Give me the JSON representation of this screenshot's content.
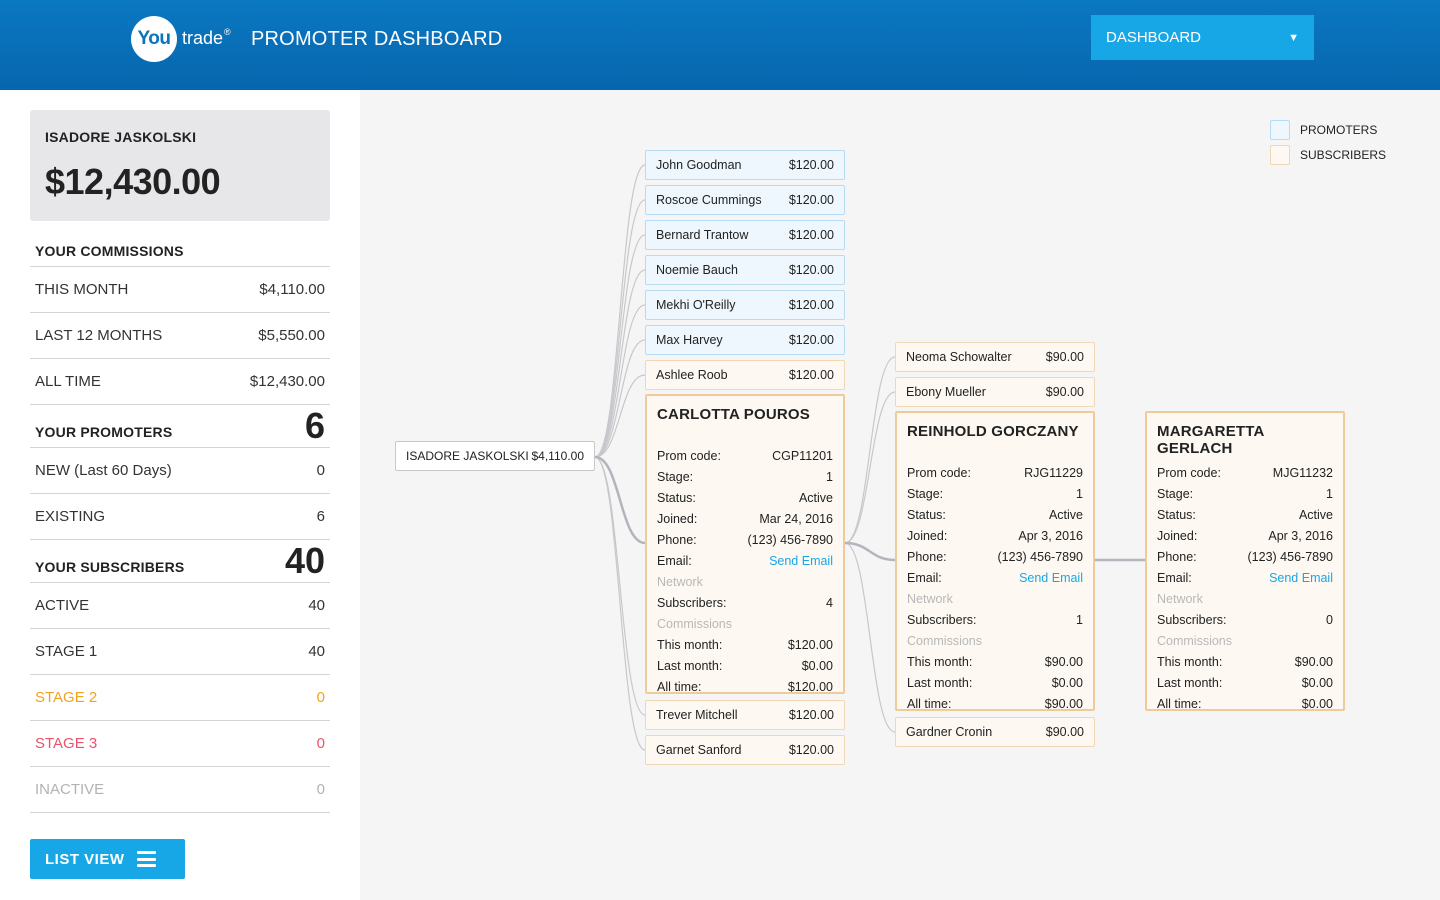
{
  "header": {
    "logo_mark": "You",
    "logo_text": "trade",
    "logo_reg": "®",
    "title": "PROMOTER DASHBOARD",
    "nav_select": {
      "value": "DASHBOARD",
      "caret": "▼"
    }
  },
  "sidebar": {
    "user_name": "ISADORE JASKOLSKI",
    "total": "$12,430.00",
    "commissions": {
      "heading": "YOUR COMMISSIONS",
      "rows": [
        {
          "label": "THIS MONTH",
          "value": "$4,110.00"
        },
        {
          "label": "LAST 12 MONTHS",
          "value": "$5,550.00"
        },
        {
          "label": "ALL TIME",
          "value": "$12,430.00"
        }
      ]
    },
    "promoters": {
      "heading": "YOUR PROMOTERS",
      "count": "6",
      "rows": [
        {
          "label": "NEW (Last 60 Days)",
          "value": "0"
        },
        {
          "label": "EXISTING",
          "value": "6"
        }
      ]
    },
    "subscribers": {
      "heading": "YOUR SUBSCRIBERS",
      "count": "40",
      "rows": [
        {
          "label": "ACTIVE",
          "value": "40"
        },
        {
          "label": "STAGE 1",
          "value": "40"
        },
        {
          "label": "STAGE 2",
          "value": "0"
        },
        {
          "label": "STAGE 3",
          "value": "0"
        },
        {
          "label": "INACTIVE",
          "value": "0"
        }
      ]
    },
    "list_view_label": "LIST VIEW",
    "colors": {
      "stage2": "#f0a31e",
      "stage3": "#e9536b",
      "inactive": "#b3b3b3",
      "accent": "#18a7e6"
    }
  },
  "legend": [
    {
      "label": "PROMOTERS",
      "color": "#eef7fd"
    },
    {
      "label": "SUBSCRIBERS",
      "color": "#fdf9f2"
    }
  ],
  "tree": {
    "root": {
      "name": "ISADORE JASKOLSKI",
      "amount": "$4,110.00"
    },
    "level1": [
      {
        "name": "John Goodman",
        "amount": "$120.00",
        "type": "promoter"
      },
      {
        "name": "Roscoe Cummings",
        "amount": "$120.00",
        "type": "promoter"
      },
      {
        "name": "Bernard Trantow",
        "amount": "$120.00",
        "type": "promoter"
      },
      {
        "name": "Noemie Bauch",
        "amount": "$120.00",
        "type": "promoter"
      },
      {
        "name": "Mekhi O'Reilly",
        "amount": "$120.00",
        "type": "promoter"
      },
      {
        "name": "Max Harvey",
        "amount": "$120.00",
        "type": "promoter"
      },
      {
        "name": "Ashlee Roob",
        "amount": "$120.00",
        "type": "subscriber"
      },
      {
        "name": "Trever Mitchell",
        "amount": "$120.00",
        "type": "subscriber"
      },
      {
        "name": "Garnet Sanford",
        "amount": "$120.00",
        "type": "subscriber"
      }
    ],
    "level2": [
      {
        "name": "Neoma Schowalter",
        "amount": "$90.00",
        "type": "subscriber"
      },
      {
        "name": "Ebony Mueller",
        "amount": "$90.00",
        "type": "subscriber"
      },
      {
        "name": "Gardner Cronin",
        "amount": "$90.00",
        "type": "subscriber"
      }
    ],
    "labels": {
      "prom_code": "Prom code:",
      "stage": "Stage:",
      "status": "Status:",
      "joined": "Joined:",
      "phone": "Phone:",
      "email": "Email:",
      "network": "Network",
      "subscribers": "Subscribers:",
      "commissions": "Commissions",
      "this_month": "This month:",
      "last_month": "Last month:",
      "all_time": "All time:"
    },
    "details": [
      {
        "name": "CARLOTTA POUROS",
        "prom_code": "CGP11201",
        "stage": "1",
        "status": "Active",
        "joined": "Mar 24, 2016",
        "phone": "(123) 456-7890",
        "email": "Send Email",
        "subscribers": "4",
        "this_month": "$120.00",
        "last_month": "$0.00",
        "all_time": "$120.00"
      },
      {
        "name": "REINHOLD GORCZANY",
        "prom_code": "RJG11229",
        "stage": "1",
        "status": "Active",
        "joined": "Apr 3, 2016",
        "phone": "(123) 456-7890",
        "email": "Send Email",
        "subscribers": "1",
        "this_month": "$90.00",
        "last_month": "$0.00",
        "all_time": "$90.00"
      },
      {
        "name": "MARGARETTA GERLACH",
        "prom_code": "MJG11232",
        "stage": "1",
        "status": "Active",
        "joined": "Apr 3, 2016",
        "phone": "(123) 456-7890",
        "email": "Send Email",
        "subscribers": "0",
        "this_month": "$90.00",
        "last_month": "$0.00",
        "all_time": "$0.00"
      }
    ]
  }
}
